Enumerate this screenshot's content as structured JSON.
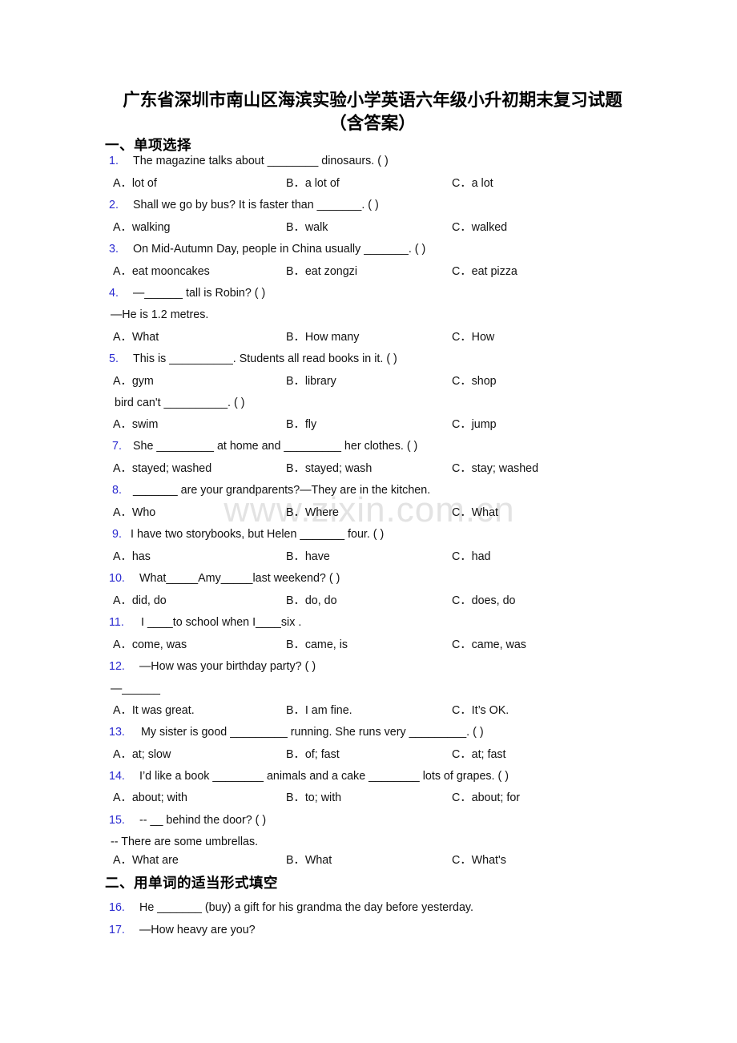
{
  "document": {
    "title_line1": "广东省深圳市南山区海滨实验小学英语六年级小升初期末复习试题",
    "title_line2": "（含答案）",
    "watermark": "www.zixin.com.cn",
    "accent_number_color": "#2a2ad0",
    "text_color": "#111111",
    "background_color": "#ffffff"
  },
  "sections": {
    "section1_heading": "一、单项选择",
    "section2_heading": "二、用单词的适当形式填空"
  },
  "questions": [
    {
      "num": "1.",
      "text": "The magazine talks about ________ dinosaurs. (   )",
      "options": [
        "A．lot of",
        "B．a lot of",
        "C．a lot"
      ]
    },
    {
      "num": "2.",
      "text": "Shall we go by bus? It is faster than _______. (  )",
      "options": [
        "A．walking",
        "B．walk",
        "C．walked"
      ]
    },
    {
      "num": "3.",
      "text": "On Mid-Autumn Day, people in China usually _______. (   )",
      "options": [
        "A．eat mooncakes",
        "B．eat zongzi",
        "C．eat pizza"
      ]
    },
    {
      "num": "4.",
      "text": "—______ tall is Robin? (  )",
      "continuation": "—He is 1.2 metres.",
      "options": [
        "A．What",
        "B．How many",
        "C．How"
      ]
    },
    {
      "num": "5.",
      "text": "This is __________. Students all read books in it. (   )",
      "options": [
        "A．gym",
        "B．library",
        "C．shop"
      ]
    },
    {
      "num": "",
      "text": "bird can't __________. (   )",
      "options": [
        "A．swim",
        "B．fly",
        "C．jump"
      ]
    },
    {
      "num": "7.",
      "text": "She _________ at home and _________ her clothes. (   )",
      "options": [
        "A．stayed; washed",
        "B．stayed; wash",
        "C．stay; washed"
      ]
    },
    {
      "num": "8.",
      "text": "_______ are your grandparents?—They are in the kitchen.",
      "options": [
        "A．Who",
        "B．Where",
        "C．What"
      ]
    },
    {
      "num": "9.",
      "text": "I have two storybooks, but Helen _______ four. (  )",
      "options": [
        "A．has",
        "B．have",
        "C．had"
      ]
    },
    {
      "num": "10.",
      "text": "What_____Amy_____last weekend? (  )",
      "options": [
        "A．did, do",
        "B．do, do",
        "C．does, do"
      ]
    },
    {
      "num": "11.",
      "text": "I ____to school when I____six .",
      "options": [
        "A．come, was",
        "B．came, is",
        "C．came, was"
      ]
    },
    {
      "num": "12.",
      "text": "—How was your birthday party? (  )",
      "continuation": "—______",
      "options": [
        "A．It was great.",
        "B．I am fine.",
        "C．It’s OK."
      ]
    },
    {
      "num": "13.",
      "text": "My sister is good _________ running. She runs very _________. (   )",
      "options": [
        "A．at; slow",
        "B．of; fast",
        "C．at; fast"
      ]
    },
    {
      "num": "14.",
      "text": "I’d like a book ________ animals and a cake ________ lots of grapes. (    )",
      "options": [
        "A．about; with",
        "B．to; with",
        "C．about; for"
      ]
    },
    {
      "num": "15.",
      "text": "-- __ behind the door?  (  )",
      "continuation": "-- There are some umbrellas.",
      "options": [
        "A．What are",
        "B．What",
        "C．What's"
      ]
    },
    {
      "num": "16.",
      "text": "He _______ (buy) a gift for his grandma the day before yesterday.",
      "options": []
    },
    {
      "num": "17.",
      "text": "—How heavy are you?",
      "options": []
    }
  ]
}
